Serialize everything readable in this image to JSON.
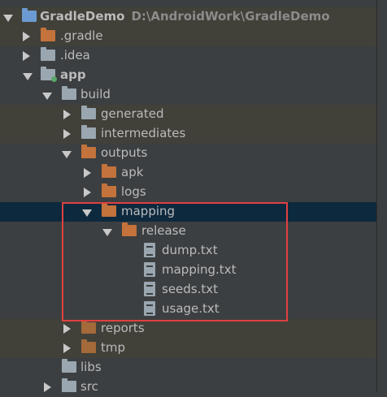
{
  "tree": {
    "root": {
      "name": "GradleDemo",
      "path": "D:\\AndroidWork\\GradleDemo"
    },
    "items": [
      {
        "label": "GradleDemo",
        "path": "D:\\AndroidWork\\GradleDemo",
        "icon": "project-folder-icon",
        "expanded": true
      },
      {
        "label": ".gradle",
        "icon": "excluded-folder-icon",
        "expanded": false
      },
      {
        "label": ".idea",
        "icon": "folder-icon",
        "expanded": false
      },
      {
        "label": "app",
        "icon": "module-folder-icon",
        "expanded": true
      },
      {
        "label": "build",
        "icon": "folder-icon",
        "expanded": true
      },
      {
        "label": "generated",
        "icon": "folder-icon",
        "expanded": false
      },
      {
        "label": "intermediates",
        "icon": "folder-icon",
        "expanded": false
      },
      {
        "label": "outputs",
        "icon": "excluded-folder-icon",
        "expanded": true
      },
      {
        "label": "apk",
        "icon": "excluded-folder-icon",
        "expanded": false
      },
      {
        "label": "logs",
        "icon": "excluded-folder-icon",
        "expanded": false
      },
      {
        "label": "mapping",
        "icon": "excluded-folder-icon",
        "expanded": true,
        "selected": true
      },
      {
        "label": "release",
        "icon": "excluded-folder-icon",
        "expanded": true
      },
      {
        "label": "dump.txt",
        "icon": "text-file-icon"
      },
      {
        "label": "mapping.txt",
        "icon": "text-file-icon"
      },
      {
        "label": "seeds.txt",
        "icon": "text-file-icon"
      },
      {
        "label": "usage.txt",
        "icon": "text-file-icon"
      },
      {
        "label": "reports",
        "icon": "excluded-folder-icon",
        "expanded": false
      },
      {
        "label": "tmp",
        "icon": "excluded-folder-icon",
        "expanded": false
      },
      {
        "label": "libs",
        "icon": "folder-icon"
      },
      {
        "label": "src",
        "icon": "folder-icon",
        "expanded": false
      }
    ]
  },
  "colors": {
    "background": "#3c3f41",
    "selected": "#0d293e",
    "highlight_box": "#e04040",
    "excluded_folder": "#c3733b"
  }
}
